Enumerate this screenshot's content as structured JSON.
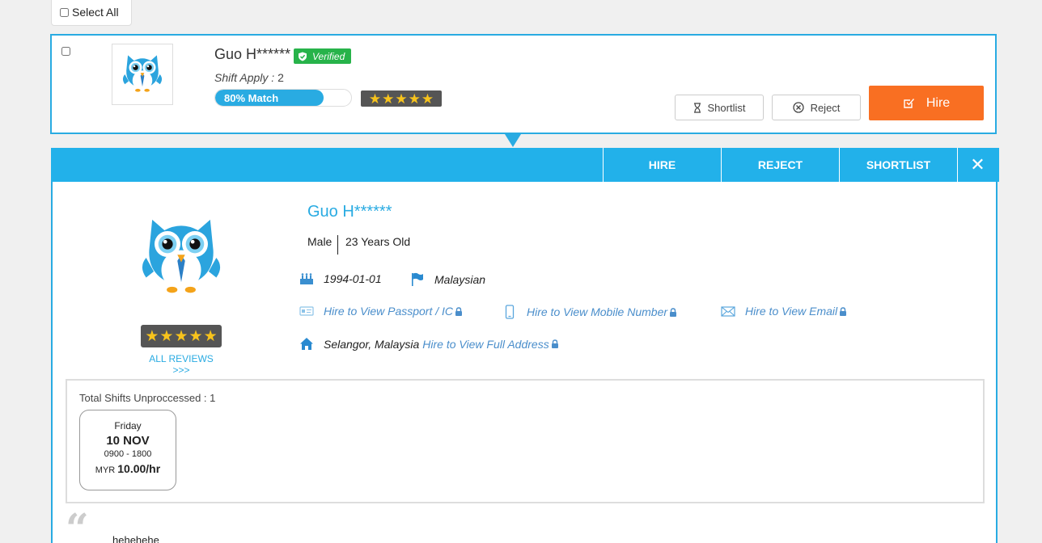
{
  "select_all": {
    "label": "Select All"
  },
  "candidate": {
    "name": "Guo H******",
    "verified_label": "Verified",
    "shift_apply_label": "Shift Apply :",
    "shift_apply_count": "2",
    "match_label": "80% Match",
    "match_percent": 80,
    "rating": 5,
    "shortlist_label": "Shortlist",
    "reject_label": "Reject",
    "hire_label": "Hire"
  },
  "detail": {
    "tabs": {
      "hire": "HIRE",
      "reject": "REJECT",
      "shortlist": "SHORTLIST",
      "close": "✕"
    },
    "name": "Guo H******",
    "gender": "Male",
    "age": "23 Years Old",
    "dob": "1994-01-01",
    "nationality": "Malaysian",
    "passport_link": "Hire to View Passport / IC",
    "mobile_link": "Hire to View Mobile Number",
    "email_link": "Hire to View Email",
    "location": "Selangor, Malaysia",
    "address_link": "Hire to View Full Address",
    "rating": 5,
    "all_reviews": "ALL REVIEWS >>>",
    "shifts_title": "Total Shifts Unproccessed : 1",
    "shift": {
      "day": "Friday",
      "date": "10 NOV",
      "time": "0900 - 1800",
      "currency": "MYR",
      "rate": "10.00/hr"
    },
    "review_text": "hehehehe"
  },
  "colors": {
    "accent": "#29abe2",
    "hire": "#f96f22",
    "verified": "#27b34a",
    "link": "#4a8ecb"
  }
}
